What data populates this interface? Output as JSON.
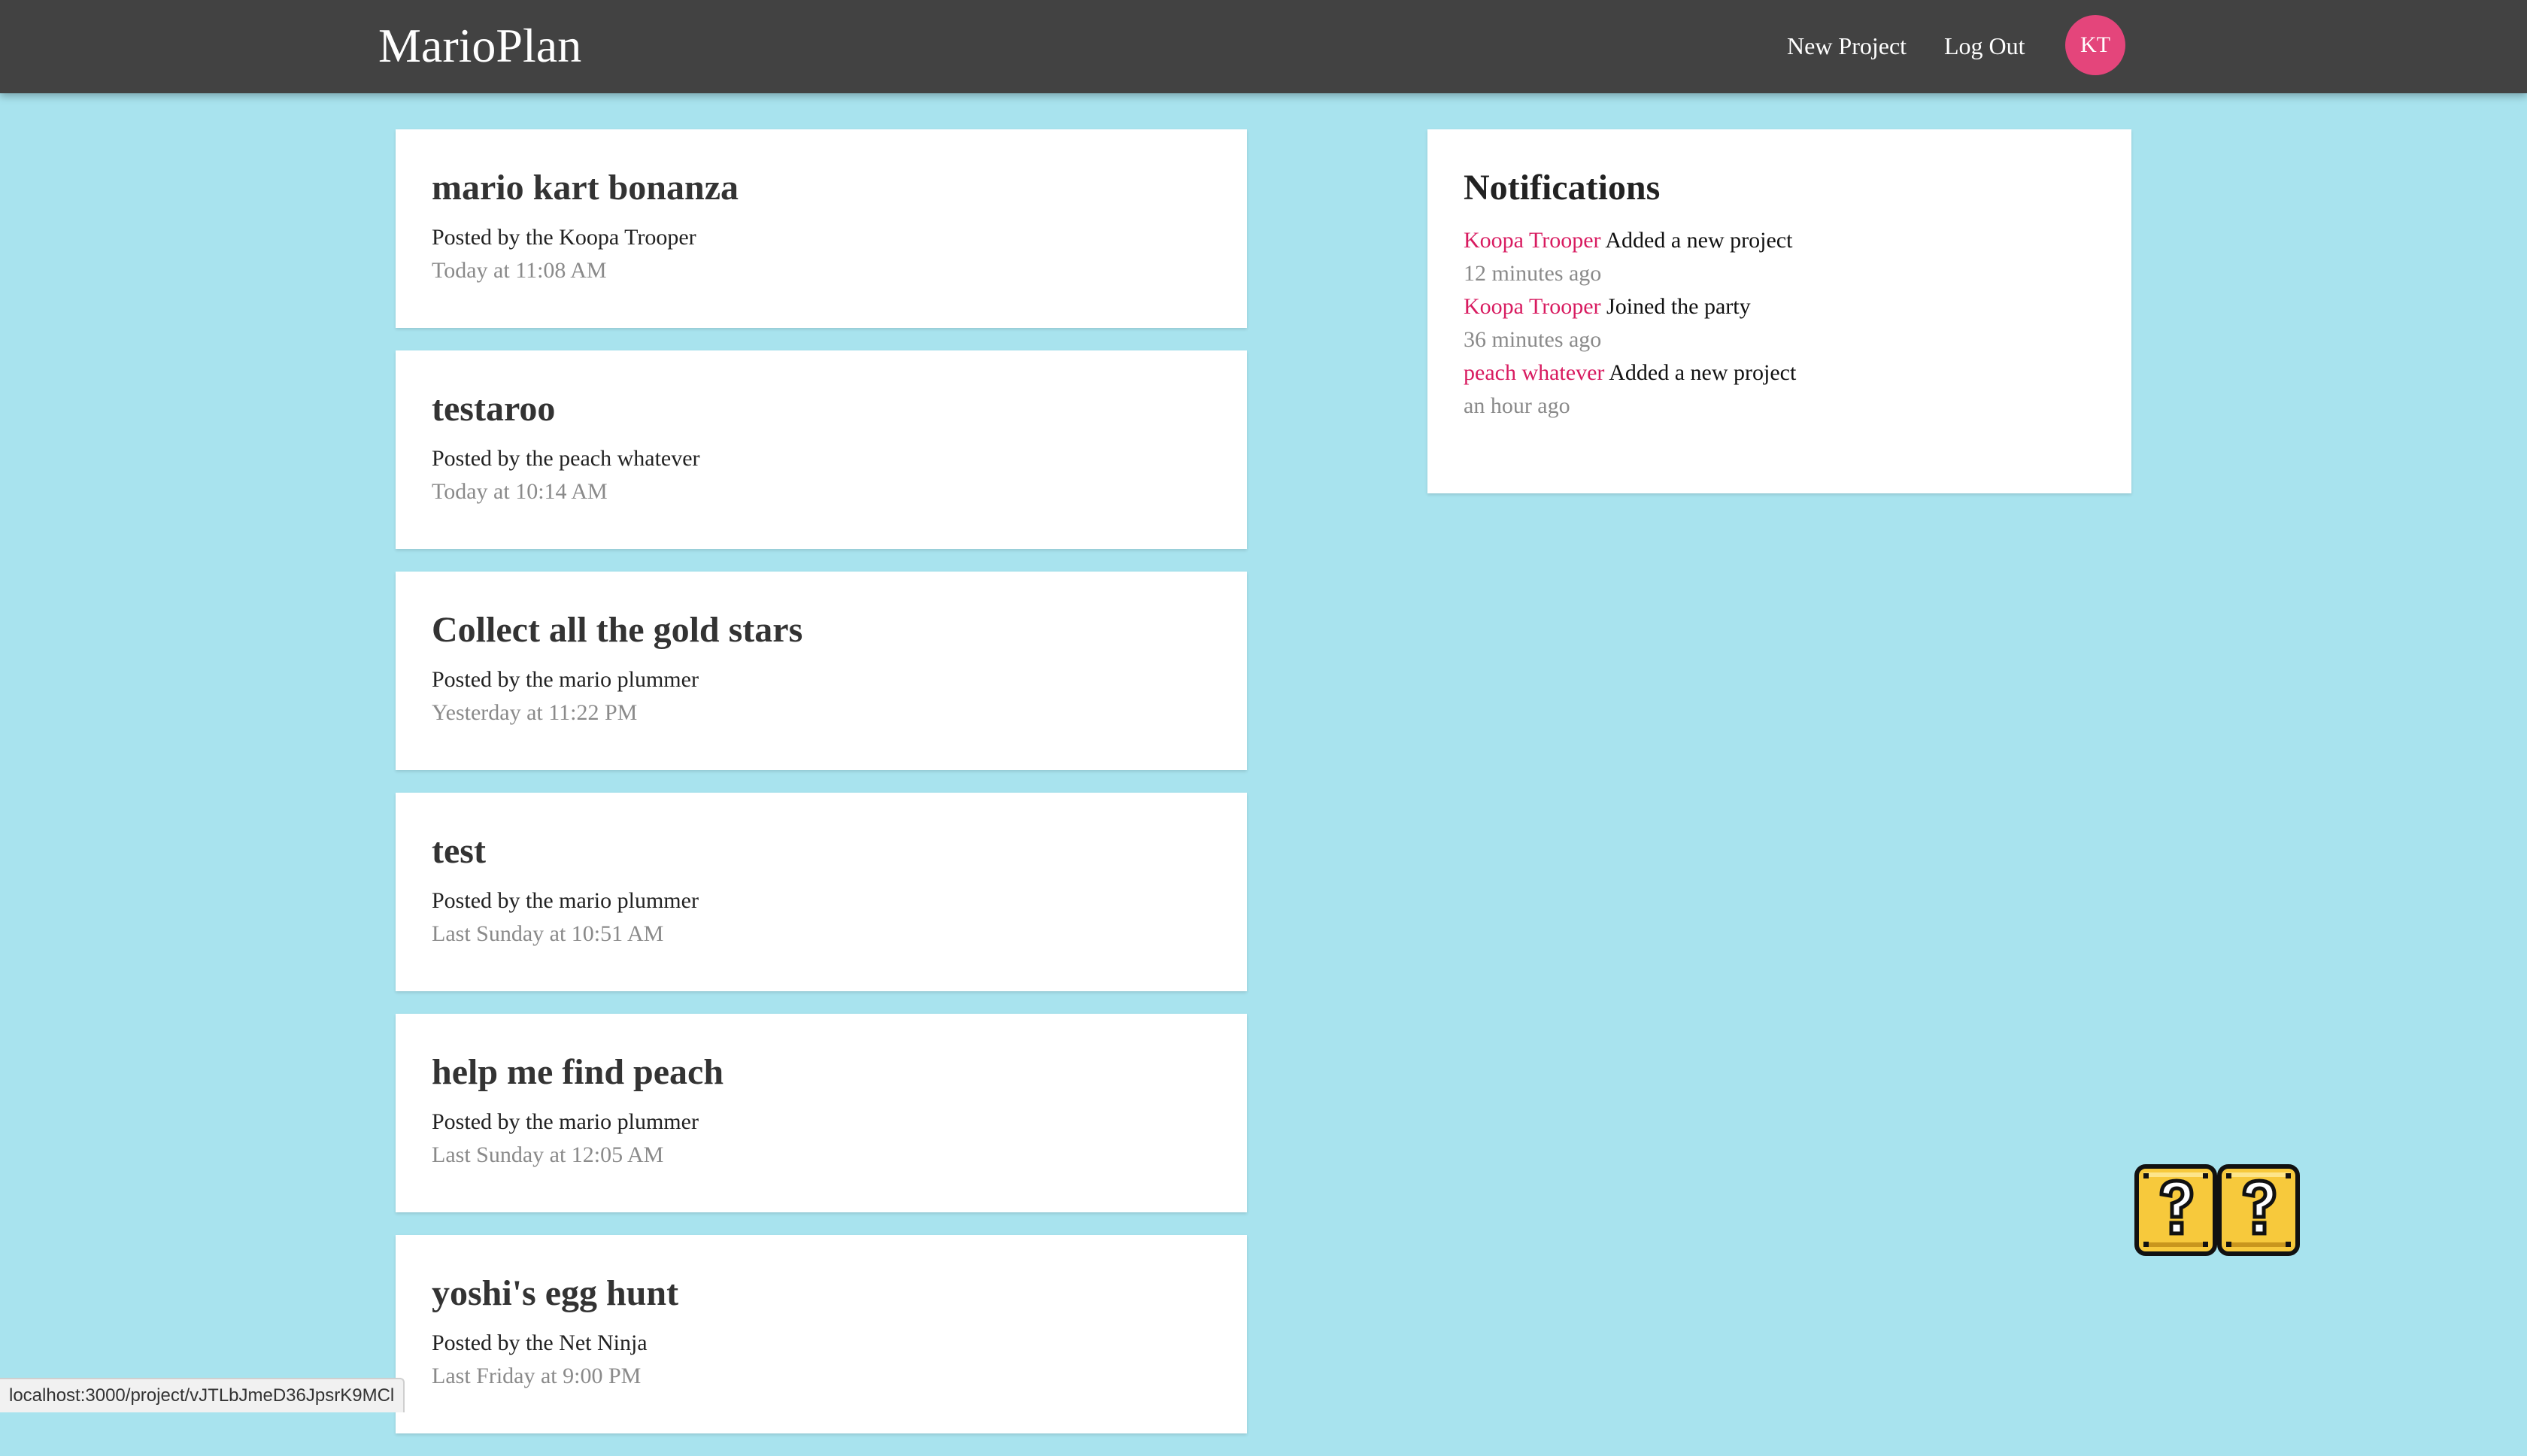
{
  "navbar": {
    "brand": "MarioPlan",
    "links": {
      "new_project": "New Project",
      "log_out": "Log Out"
    },
    "avatar_initials": "KT"
  },
  "projects": [
    {
      "title": "mario kart bonanza",
      "author": "Posted by the Koopa Trooper",
      "date": "Today at 11:08 AM"
    },
    {
      "title": "testaroo",
      "author": "Posted by the peach whatever",
      "date": "Today at 10:14 AM"
    },
    {
      "title": "Collect all the gold stars",
      "author": "Posted by the mario plummer",
      "date": "Yesterday at 11:22 PM"
    },
    {
      "title": "test",
      "author": "Posted by the mario plummer",
      "date": "Last Sunday at 10:51 AM"
    },
    {
      "title": "help me find peach",
      "author": "Posted by the mario plummer",
      "date": "Last Sunday at 12:05 AM"
    },
    {
      "title": "yoshi's egg hunt",
      "author": "Posted by the Net Ninja",
      "date": "Last Friday at 9:00 PM"
    }
  ],
  "notifications": {
    "heading": "Notifications",
    "items": [
      {
        "user": "Koopa Trooper",
        "content": "Added a new project",
        "time": "12 minutes ago"
      },
      {
        "user": "Koopa Trooper",
        "content": "Joined the party",
        "time": "36 minutes ago"
      },
      {
        "user": "peach whatever",
        "content": "Added a new project",
        "time": "an hour ago"
      }
    ]
  },
  "status_bar": {
    "url": "localhost:3000/project/vJTLbJmeD36JpsrK9MCl"
  },
  "colors": {
    "background": "#a8e3ee",
    "navbar": "#424242",
    "avatar": "#e4457b",
    "notification_user": "#d81b60"
  },
  "decorations": {
    "question_blocks_icon": "question-block-icon"
  }
}
